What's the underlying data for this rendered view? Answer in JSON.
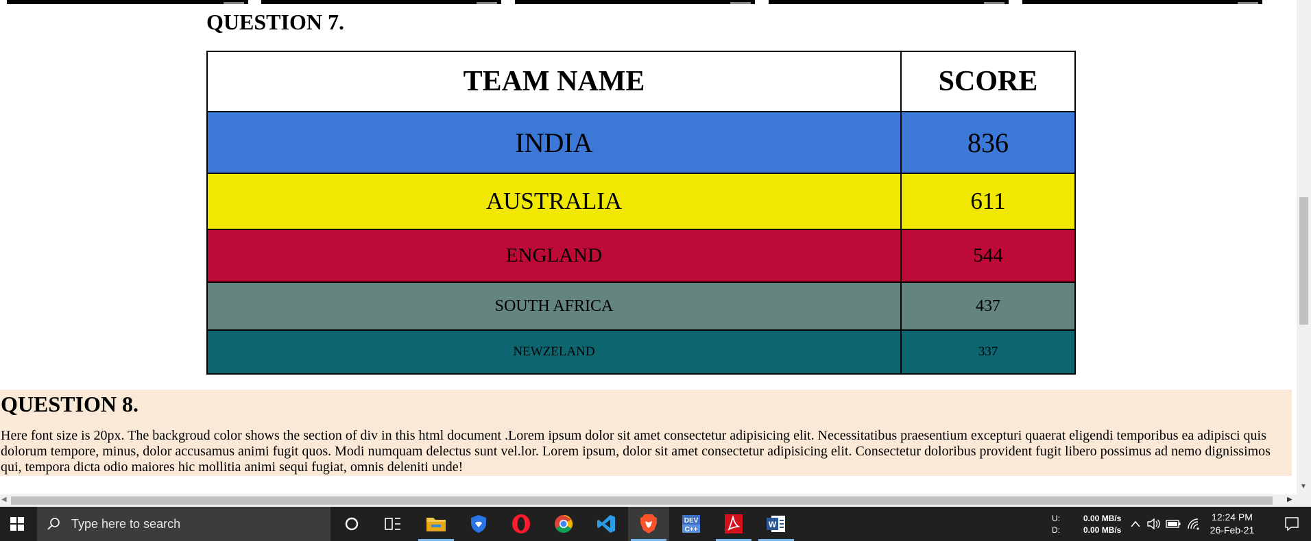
{
  "question7": {
    "heading": "QUESTION 7.",
    "headers": {
      "team": "TEAM NAME",
      "score": "SCORE"
    },
    "rows": [
      {
        "team": "INDIA",
        "score": "836",
        "bg": "#3b78d8"
      },
      {
        "team": "AUSTRALIA",
        "score": "611",
        "bg": "#f0e800"
      },
      {
        "team": "ENGLAND",
        "score": "544",
        "bg": "#be0a36"
      },
      {
        "team": "SOUTH AFRICA",
        "score": "437",
        "bg": "#64847f"
      },
      {
        "team": "NEWZELAND",
        "score": "337",
        "bg": "#0e6670"
      }
    ]
  },
  "question8": {
    "heading": "QUESTION 8.",
    "text": "Here font size is 20px. The backgroud color shows the section of div in this html document .Lorem ipsum dolor sit amet consectetur adipisicing elit. Necessitatibus praesentium excepturi quaerat eligendi temporibus ea adipisci quis dolorum tempore, minus, dolor accusamus animi fugit quos. Modi numquam delectus sunt vel.lor. Lorem ipsum, dolor sit amet consectetur adipisicing elit. Consectetur doloribus provident fugit libero possimus ad nemo dignissimos qui, tempora dicta odio maiores hic mollitia animi sequi fugiat, omnis deleniti unde!",
    "bg": "#f9e9d6"
  },
  "taskbar": {
    "search_placeholder": "Type here to search",
    "apps": [
      "file-explorer",
      "brave-shield",
      "opera",
      "chrome",
      "vscode",
      "brave",
      "dev-c++",
      "acrobat",
      "word"
    ],
    "network": {
      "up_label": "U:",
      "down_label": "D:",
      "up": "0.00 MB/s",
      "down": "0.00 MB/s"
    },
    "time": "12:24 PM",
    "date": "26-Feb-21"
  }
}
